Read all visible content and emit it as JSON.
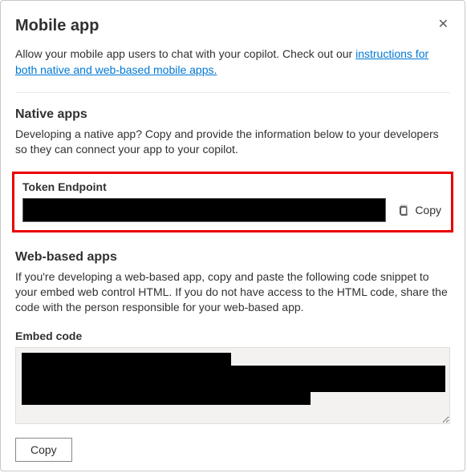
{
  "header": {
    "title": "Mobile app",
    "close_label": "✕"
  },
  "intro": {
    "text_before": "Allow your mobile app users to chat with your copilot. Check out our ",
    "link_text": "instructions for both native and web-based mobile apps."
  },
  "native": {
    "title": "Native apps",
    "description": "Developing a native app? Copy and provide the information below to your developers so they can connect your app to your copilot.",
    "token_label": "Token Endpoint",
    "token_value": "",
    "copy_label": "Copy"
  },
  "web": {
    "title": "Web-based apps",
    "description": "If you're developing a web-based app, copy and paste the following code snippet to your embed web control HTML. If you do not have access to the HTML code, share the code with the person responsible for your web-based app.",
    "embed_label": "Embed code",
    "embed_value": "",
    "copy_button": "Copy"
  }
}
